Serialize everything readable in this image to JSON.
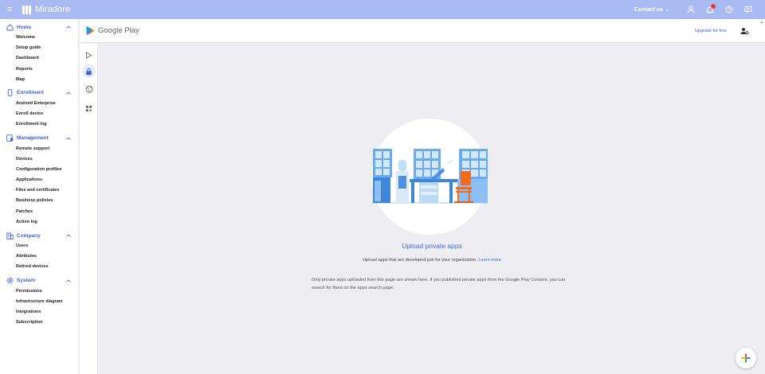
{
  "topbar": {
    "app_name": "Miradore",
    "contact_label": "Contact us ⌄"
  },
  "sidebar": {
    "sections": [
      {
        "label": "Home",
        "items": [
          "Welcome",
          "Setup guide",
          "Dashboard",
          "Reports",
          "Map"
        ]
      },
      {
        "label": "Enrollment",
        "items": [
          "Android Enterprise",
          "Enroll device",
          "Enrollment log"
        ]
      },
      {
        "label": "Management",
        "items": [
          "Remote support",
          "Devices",
          "Configuration profiles",
          "Applications",
          "Files and certificates",
          "Business policies",
          "Patches",
          "Action log"
        ]
      },
      {
        "label": "Company",
        "items": [
          "Users",
          "Attributes",
          "Retired devices"
        ]
      },
      {
        "label": "System",
        "items": [
          "Permissions",
          "Infrastructure diagram",
          "Integrations",
          "Subscription"
        ]
      }
    ]
  },
  "header": {
    "store_name": "Google Play",
    "upgrade_label": "Upgrade for free"
  },
  "main": {
    "title": "Upload private apps",
    "subtitle": "Upload apps that are developed just for your organization.",
    "learn_more": "Learn more",
    "note": "Only private apps uploaded from this page are shown here. If you published private apps from the Google Play Console, you can search for them on the apps search page."
  },
  "colors": {
    "topbar": "#a9b9f2",
    "accent": "#3f63d8",
    "background": "#eeeef2"
  },
  "icons": {
    "top_right": [
      "person-icon",
      "notifications-icon",
      "help-icon",
      "chat-icon"
    ],
    "rail": [
      "play-apps-icon",
      "private-apps-icon",
      "web-apps-icon",
      "organize-apps-icon"
    ],
    "fab": "add-icon"
  }
}
